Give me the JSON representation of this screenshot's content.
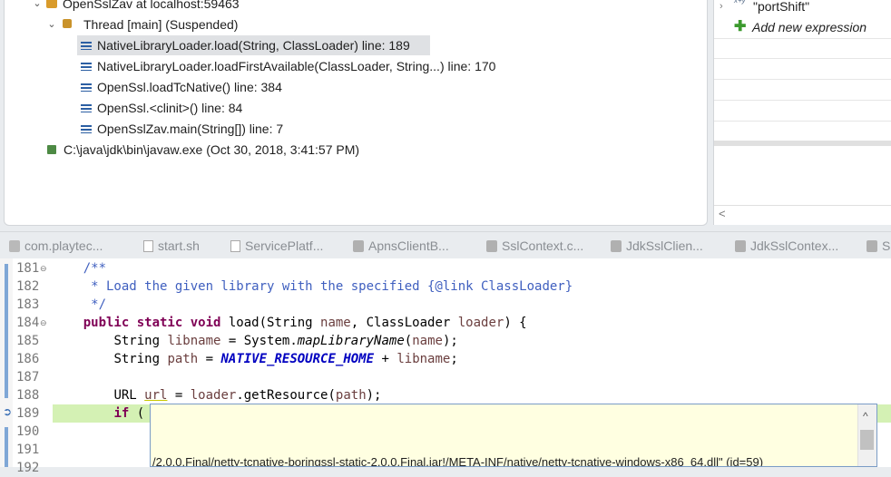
{
  "debug": {
    "rows": [
      {
        "label": "OpenSslZav at localhost:59463",
        "icon": "debug-target-icon",
        "twisty": "⌄"
      },
      {
        "label": "Thread [main] (Suspended)",
        "icon": "suspended-thread-icon",
        "twisty": "⌄"
      },
      {
        "label": "NativeLibraryLoader.load(String, ClassLoader) line: 189",
        "icon": "stack-frame-icon",
        "selected": true
      },
      {
        "label": "NativeLibraryLoader.loadFirstAvailable(ClassLoader, String...) line: 170",
        "icon": "stack-frame-icon"
      },
      {
        "label": "OpenSsl.loadTcNative() line: 384",
        "icon": "stack-frame-icon"
      },
      {
        "label": "OpenSsl.<clinit>() line: 84",
        "icon": "stack-frame-icon"
      },
      {
        "label": "OpenSslZav.main(String[]) line: 7",
        "icon": "stack-frame-icon"
      },
      {
        "label": "C:\\java\\jdk\\bin\\javaw.exe (Oct 30, 2018, 3:41:57 PM)",
        "icon": "process-icon"
      }
    ]
  },
  "expressions": {
    "item": {
      "glyph": "x+y",
      "label": "\"portShift\""
    },
    "add_label": "Add new expression",
    "scroll_left": "<"
  },
  "tabs": [
    {
      "label": "com.playtec...",
      "icon": "class-file-icon"
    },
    {
      "label": "start.sh",
      "icon": "file-icon"
    },
    {
      "label": "ServicePlatf...",
      "icon": "class-file-icon"
    },
    {
      "label": "ApnsClientB...",
      "icon": "class-file-icon"
    },
    {
      "label": "SslContext.c...",
      "icon": "binary-class-icon"
    },
    {
      "label": "JdkSslClien...",
      "icon": "binary-class-icon"
    },
    {
      "label": "JdkSslContex...",
      "icon": "binary-class-icon"
    },
    {
      "label": "SS",
      "icon": "binary-class-icon"
    }
  ],
  "editor": {
    "line_numbers": [
      "181",
      "182",
      "183",
      "184",
      "185",
      "186",
      "187",
      "188",
      "189",
      "190",
      "191",
      "192"
    ],
    "current_line": "189",
    "code": {
      "l181": "    /**",
      "l182": "     * Load the given library with the specified {@link ClassLoader}",
      "l183": "     */",
      "l184_kw": "public static void",
      "l184_rest": " load(String ",
      "l184_p1": "name",
      "l184_mid": ", ClassLoader ",
      "l184_p2": "loader",
      "l184_end": ") {",
      "l185_a": "String ",
      "l185_v": "libname",
      "l185_b": " = System.",
      "l185_m": "mapLibraryName",
      "l185_c": "(",
      "l185_p": "name",
      "l185_d": ");",
      "l186_a": "String ",
      "l186_v": "path",
      "l186_b": " = ",
      "l186_s": "NATIVE_RESOURCE_HOME",
      "l186_c": " + ",
      "l186_p": "libname",
      "l186_d": ";",
      "l188_a": "URL ",
      "l188_v": "url",
      "l188_b": " = ",
      "l188_p": "loader",
      "l188_c": ".getResource(",
      "l188_q": "path",
      "l188_d": ");",
      "l189_kw": "if",
      "l189_rest": " ("
    }
  },
  "hover": {
    "text": "/2.0.0.Final/netty-tcnative-boringssl-static-2.0.0.Final.jar!/META-INF/native/netty-tcnative-windows-x86_64.dll\" (id=59)",
    "scroll_up": "^"
  }
}
